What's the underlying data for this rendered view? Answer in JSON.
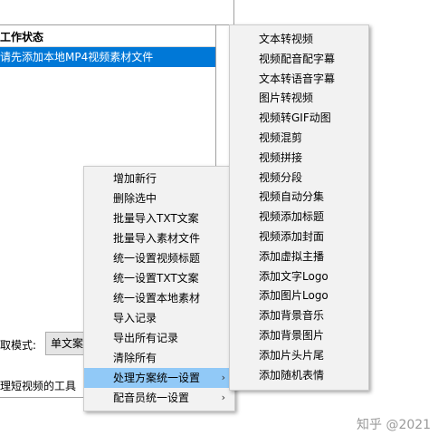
{
  "background": {
    "list_header": "工作状态",
    "list_selected_row": "请先添加本地MP4视频素材文件",
    "mode_label": "取模式:",
    "mode_select_value": "单文案",
    "footer_text": "理短视频的工具"
  },
  "context_menu": {
    "items": [
      {
        "label": "增加新行"
      },
      {
        "label": "删除选中"
      },
      {
        "label": "批量导入TXT文案"
      },
      {
        "label": "批量导入素材文件"
      },
      {
        "label": "统一设置视频标题"
      },
      {
        "label": "统一设置TXT文案"
      },
      {
        "label": "统一设置本地素材"
      },
      {
        "label": "导入记录"
      },
      {
        "label": "导出所有记录"
      },
      {
        "label": "清除所有"
      },
      {
        "label": "处理方案统一设置",
        "submenu": true,
        "active": true
      },
      {
        "label": "配音员统一设置",
        "submenu": true
      }
    ]
  },
  "submenu": {
    "items": [
      {
        "label": "文本转视频"
      },
      {
        "label": "视频配音配字幕"
      },
      {
        "label": "文本转语音字幕"
      },
      {
        "label": "图片转视频"
      },
      {
        "label": "视频转GIF动图"
      },
      {
        "label": "视频混剪"
      },
      {
        "label": "视频拼接"
      },
      {
        "label": "视频分段"
      },
      {
        "label": "视频自动分集"
      },
      {
        "label": "视频添加标题"
      },
      {
        "label": "视频添加封面"
      },
      {
        "label": "添加虚拟主播"
      },
      {
        "label": "添加文字Logo"
      },
      {
        "label": "添加图片Logo"
      },
      {
        "label": "添加背景音乐"
      },
      {
        "label": "添加背景图片"
      },
      {
        "label": "添加片头片尾"
      },
      {
        "label": "添加随机表情"
      }
    ]
  },
  "watermark": "知乎 @2021",
  "colors": {
    "selection": "#0078d7",
    "menu_highlight": "#91c9f7",
    "menu_bg": "#f2f2f2"
  }
}
